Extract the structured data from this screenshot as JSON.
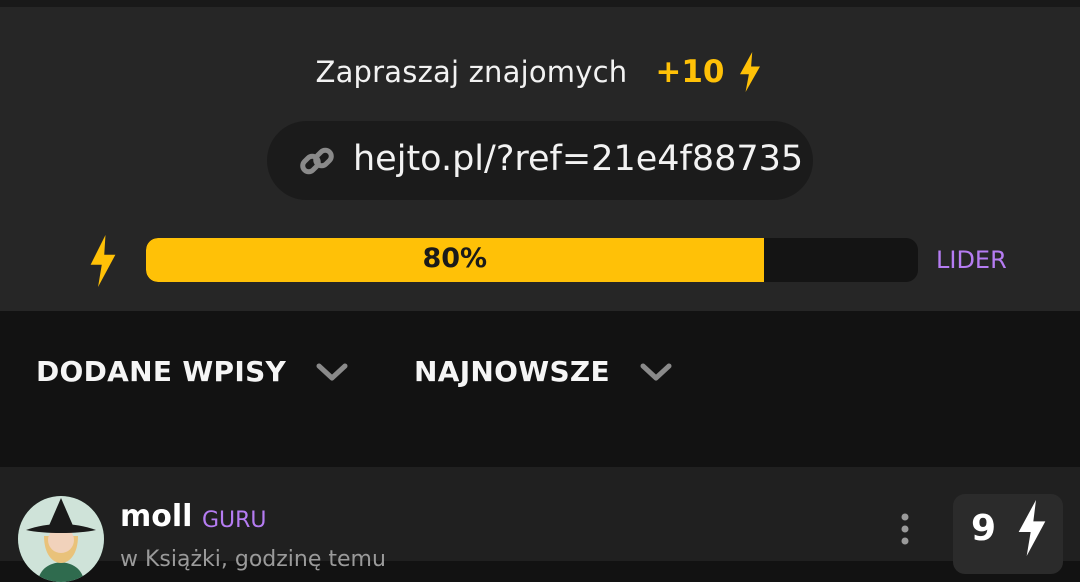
{
  "invite": {
    "text": "Zapraszaj znajomych",
    "bonus": "+10",
    "ref_url": "hejto.pl/?ref=21e4f88735"
  },
  "progress": {
    "value": 0.8,
    "label": "80%",
    "rank": "LIDER"
  },
  "filters": [
    {
      "label": "DODANE WPISY"
    },
    {
      "label": "NAJNOWSZE"
    }
  ],
  "post": {
    "author": "moll",
    "badge": "GURU",
    "meta": "w Książki, godzinę temu",
    "score": "9"
  },
  "colors": {
    "accent": "#ffc107",
    "rank": "#b57cf2",
    "card": "#262626",
    "background": "#121212"
  },
  "icons": [
    "lightning-icon",
    "link-icon",
    "chevron-down-icon",
    "more-vertical-icon",
    "avatar"
  ]
}
